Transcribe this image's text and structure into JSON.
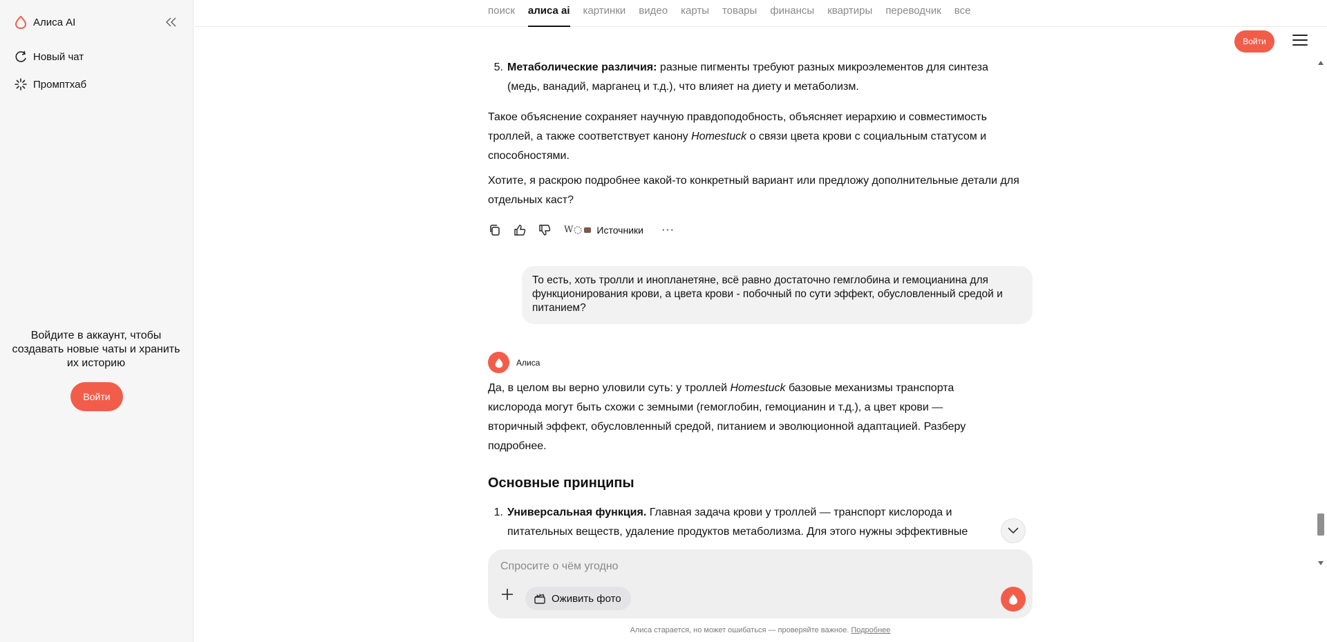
{
  "sidebar": {
    "title": "Алиса AI",
    "items": [
      {
        "label": "Новый чат"
      },
      {
        "label": "Промптхаб"
      }
    ],
    "login_prompt": "Войдите в аккаунт, чтобы создавать новые чаты и хранить их историю",
    "login_button": "Войти"
  },
  "nav": {
    "tabs": [
      "поиск",
      "алиса ai",
      "картинки",
      "видео",
      "карты",
      "товары",
      "финансы",
      "квартиры",
      "переводчик",
      "все"
    ],
    "active_tab": "алиса ai"
  },
  "header": {
    "login_button": "Войти"
  },
  "messages": {
    "prev_answer": {
      "item5_num": "5.",
      "item5_bold": "Метаболические различия:",
      "item5_rest": " разные пигменты требуют разных микроэлементов для синтеза (медь, ванадий, марганец и т.д.), что влияет на диету и метаболизм.",
      "para1_a": "Такое объяснение сохраняет научную правдоподобность, объясняет иерархию и совместимость троллей, а также соответствует канону ",
      "para1_em": "Homestuck",
      "para1_b": " о связи цвета крови с социальным статусом и способностями.",
      "para2": "Хотите, я раскрою подробнее какой-то конкретный вариант или предложу дополнительные детали для отдельных каст?",
      "sources_label": "Источники",
      "sources_glyph": "W"
    },
    "user_question": "То есть, хоть тролли и инопланетяне, всё равно достаточно гемглобина и гемоцианина для функционирования крови, а цвета крови - побочный по сути эффект, обусловленный средой и питанием?",
    "answer": {
      "author": "Алиса",
      "intro_a": "Да, в целом вы верно уловили суть: у троллей ",
      "intro_em": "Homestuck",
      "intro_b": " базовые механизмы транспорта кислорода могут быть схожи с земными (гемоглобин, гемоцианин и т.д.), а цвет крови — вторичный эффект, обусловленный средой, питанием и эволюционной адаптацией. Разберу подробнее.",
      "heading": "Основные принципы",
      "item1_num": "1.",
      "item1_bold": "Универсальная функция.",
      "item1_rest": " Главная задача крови у троллей — транспорт кислорода и питательных веществ, удаление продуктов метаболизма. Для этого нужны эффективные"
    }
  },
  "composer": {
    "placeholder": "Спросите о чём угодно",
    "revive_label": "Оживить фото"
  },
  "footer": {
    "disclaimer": "Алиса старается, но может ошибаться — проверяйте важное.",
    "more_link": "Подробнее"
  },
  "colors": {
    "accent": "#f25d4a",
    "sidebar_bg": "#f6f6f7",
    "bubble_bg": "#f2f2f3"
  },
  "icons": [
    "alice-logo-icon",
    "collapse-icon",
    "new-chat-icon",
    "prompthub-icon",
    "copy-icon",
    "thumb-up-icon",
    "thumb-down-icon",
    "more-icon",
    "chevron-down-icon",
    "plus-icon",
    "clapperboard-icon",
    "alice-send-icon",
    "menu-icon"
  ]
}
